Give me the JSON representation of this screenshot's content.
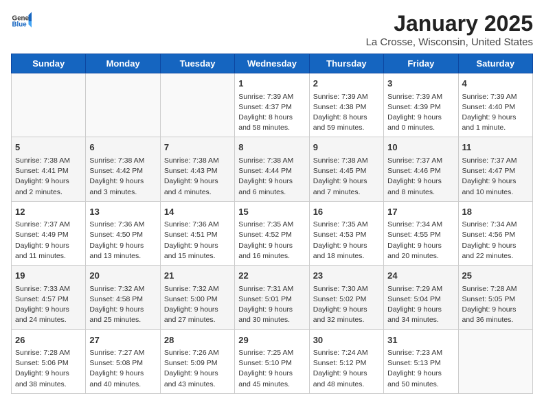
{
  "header": {
    "logo_general": "General",
    "logo_blue": "Blue",
    "month_year": "January 2025",
    "location": "La Crosse, Wisconsin, United States"
  },
  "days_of_week": [
    "Sunday",
    "Monday",
    "Tuesday",
    "Wednesday",
    "Thursday",
    "Friday",
    "Saturday"
  ],
  "weeks": [
    [
      {
        "day": "",
        "info": ""
      },
      {
        "day": "",
        "info": ""
      },
      {
        "day": "",
        "info": ""
      },
      {
        "day": "1",
        "info": "Sunrise: 7:39 AM\nSunset: 4:37 PM\nDaylight: 8 hours and 58 minutes."
      },
      {
        "day": "2",
        "info": "Sunrise: 7:39 AM\nSunset: 4:38 PM\nDaylight: 8 hours and 59 minutes."
      },
      {
        "day": "3",
        "info": "Sunrise: 7:39 AM\nSunset: 4:39 PM\nDaylight: 9 hours and 0 minutes."
      },
      {
        "day": "4",
        "info": "Sunrise: 7:39 AM\nSunset: 4:40 PM\nDaylight: 9 hours and 1 minute."
      }
    ],
    [
      {
        "day": "5",
        "info": "Sunrise: 7:38 AM\nSunset: 4:41 PM\nDaylight: 9 hours and 2 minutes."
      },
      {
        "day": "6",
        "info": "Sunrise: 7:38 AM\nSunset: 4:42 PM\nDaylight: 9 hours and 3 minutes."
      },
      {
        "day": "7",
        "info": "Sunrise: 7:38 AM\nSunset: 4:43 PM\nDaylight: 9 hours and 4 minutes."
      },
      {
        "day": "8",
        "info": "Sunrise: 7:38 AM\nSunset: 4:44 PM\nDaylight: 9 hours and 6 minutes."
      },
      {
        "day": "9",
        "info": "Sunrise: 7:38 AM\nSunset: 4:45 PM\nDaylight: 9 hours and 7 minutes."
      },
      {
        "day": "10",
        "info": "Sunrise: 7:37 AM\nSunset: 4:46 PM\nDaylight: 9 hours and 8 minutes."
      },
      {
        "day": "11",
        "info": "Sunrise: 7:37 AM\nSunset: 4:47 PM\nDaylight: 9 hours and 10 minutes."
      }
    ],
    [
      {
        "day": "12",
        "info": "Sunrise: 7:37 AM\nSunset: 4:49 PM\nDaylight: 9 hours and 11 minutes."
      },
      {
        "day": "13",
        "info": "Sunrise: 7:36 AM\nSunset: 4:50 PM\nDaylight: 9 hours and 13 minutes."
      },
      {
        "day": "14",
        "info": "Sunrise: 7:36 AM\nSunset: 4:51 PM\nDaylight: 9 hours and 15 minutes."
      },
      {
        "day": "15",
        "info": "Sunrise: 7:35 AM\nSunset: 4:52 PM\nDaylight: 9 hours and 16 minutes."
      },
      {
        "day": "16",
        "info": "Sunrise: 7:35 AM\nSunset: 4:53 PM\nDaylight: 9 hours and 18 minutes."
      },
      {
        "day": "17",
        "info": "Sunrise: 7:34 AM\nSunset: 4:55 PM\nDaylight: 9 hours and 20 minutes."
      },
      {
        "day": "18",
        "info": "Sunrise: 7:34 AM\nSunset: 4:56 PM\nDaylight: 9 hours and 22 minutes."
      }
    ],
    [
      {
        "day": "19",
        "info": "Sunrise: 7:33 AM\nSunset: 4:57 PM\nDaylight: 9 hours and 24 minutes."
      },
      {
        "day": "20",
        "info": "Sunrise: 7:32 AM\nSunset: 4:58 PM\nDaylight: 9 hours and 25 minutes."
      },
      {
        "day": "21",
        "info": "Sunrise: 7:32 AM\nSunset: 5:00 PM\nDaylight: 9 hours and 27 minutes."
      },
      {
        "day": "22",
        "info": "Sunrise: 7:31 AM\nSunset: 5:01 PM\nDaylight: 9 hours and 30 minutes."
      },
      {
        "day": "23",
        "info": "Sunrise: 7:30 AM\nSunset: 5:02 PM\nDaylight: 9 hours and 32 minutes."
      },
      {
        "day": "24",
        "info": "Sunrise: 7:29 AM\nSunset: 5:04 PM\nDaylight: 9 hours and 34 minutes."
      },
      {
        "day": "25",
        "info": "Sunrise: 7:28 AM\nSunset: 5:05 PM\nDaylight: 9 hours and 36 minutes."
      }
    ],
    [
      {
        "day": "26",
        "info": "Sunrise: 7:28 AM\nSunset: 5:06 PM\nDaylight: 9 hours and 38 minutes."
      },
      {
        "day": "27",
        "info": "Sunrise: 7:27 AM\nSunset: 5:08 PM\nDaylight: 9 hours and 40 minutes."
      },
      {
        "day": "28",
        "info": "Sunrise: 7:26 AM\nSunset: 5:09 PM\nDaylight: 9 hours and 43 minutes."
      },
      {
        "day": "29",
        "info": "Sunrise: 7:25 AM\nSunset: 5:10 PM\nDaylight: 9 hours and 45 minutes."
      },
      {
        "day": "30",
        "info": "Sunrise: 7:24 AM\nSunset: 5:12 PM\nDaylight: 9 hours and 48 minutes."
      },
      {
        "day": "31",
        "info": "Sunrise: 7:23 AM\nSunset: 5:13 PM\nDaylight: 9 hours and 50 minutes."
      },
      {
        "day": "",
        "info": ""
      }
    ]
  ]
}
